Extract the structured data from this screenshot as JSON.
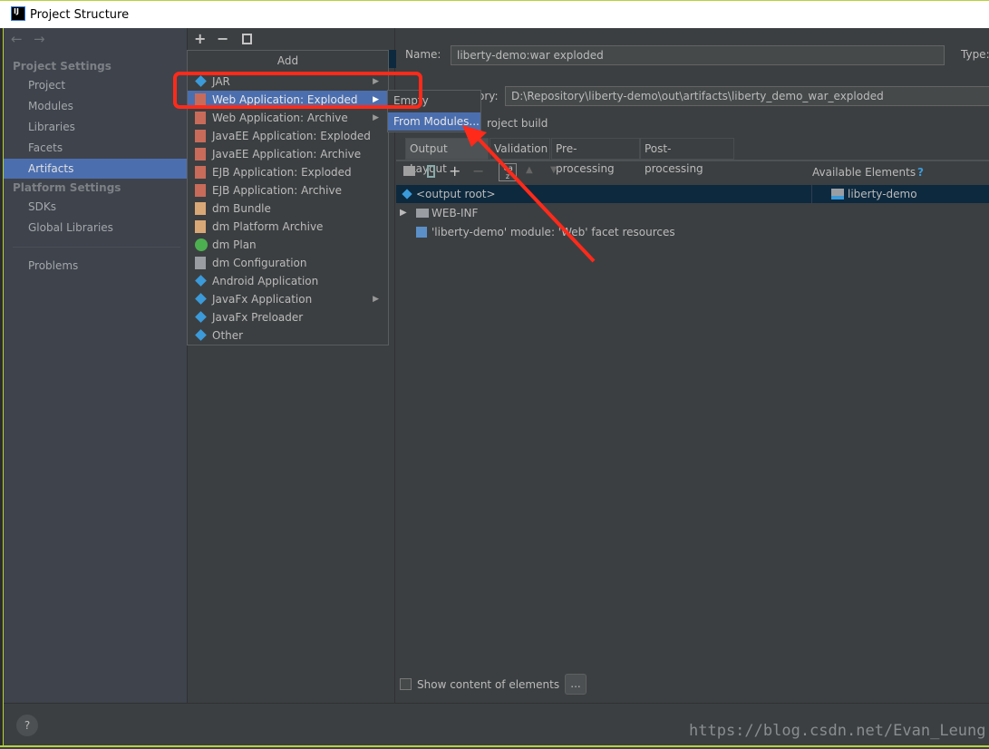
{
  "window": {
    "title": "Project Structure",
    "logo": "IJ"
  },
  "sidebar": {
    "section1": "Project Settings",
    "items1": [
      "Project",
      "Modules",
      "Libraries",
      "Facets",
      "Artifacts"
    ],
    "selected": "Artifacts",
    "section2": "Platform Settings",
    "items2": [
      "SDKs",
      "Global Libraries"
    ],
    "problems": "Problems"
  },
  "toolbar": {
    "add": "+",
    "remove": "−",
    "copy": "copy-icon"
  },
  "menu": {
    "header": "Add",
    "items": [
      {
        "label": "JAR",
        "icon": "jar-icon",
        "submenu": true
      },
      {
        "label": "Web Application: Exploded",
        "icon": "web-app-icon",
        "submenu": true,
        "selected": true
      },
      {
        "label": "Web Application: Archive",
        "icon": "web-app-icon",
        "submenu": true
      },
      {
        "label": "JavaEE Application: Exploded",
        "icon": "javaee-icon"
      },
      {
        "label": "JavaEE Application: Archive",
        "icon": "javaee-icon"
      },
      {
        "label": "EJB Application: Exploded",
        "icon": "ejb-icon"
      },
      {
        "label": "EJB Application: Archive",
        "icon": "ejb-icon"
      },
      {
        "label": "dm Bundle",
        "icon": "dm-bundle-icon"
      },
      {
        "label": "dm Platform Archive",
        "icon": "dm-archive-icon"
      },
      {
        "label": "dm Plan",
        "icon": "dm-plan-icon"
      },
      {
        "label": "dm Configuration",
        "icon": "document-icon"
      },
      {
        "label": "Android Application",
        "icon": "artifact-icon"
      },
      {
        "label": "JavaFx Application",
        "icon": "artifact-icon",
        "submenu": true
      },
      {
        "label": "JavaFx Preloader",
        "icon": "artifact-icon"
      },
      {
        "label": "Other",
        "icon": "artifact-icon"
      }
    ]
  },
  "submenu": {
    "items": [
      "Empty",
      "From Modules..."
    ],
    "selected": "From Modules..."
  },
  "form": {
    "name_label": "Name:",
    "name_value": "liberty-demo:war exploded",
    "type_label": "Type:",
    "output_label": "ory:",
    "output_value": "D:\\Repository\\liberty-demo\\out\\artifacts\\liberty_demo_war_exploded",
    "build_label": "roject build"
  },
  "tabs": [
    "Output Layout",
    "Validation",
    "Pre-processing",
    "Post-processing"
  ],
  "tree": {
    "rows": [
      "<output root>",
      "WEB-INF",
      "'liberty-demo' module: 'Web' facet resources"
    ],
    "available_label": "Available Elements",
    "available_help": "?",
    "available_items": [
      "liberty-demo"
    ]
  },
  "footer": {
    "show_content": "Show content of elements",
    "show_content_checked": false,
    "more": "...",
    "help": "?",
    "watermark": "https://blog.csdn.net/Evan_Leung"
  },
  "colors": {
    "selection": "#4b6eaf",
    "tree_selection": "#0d293e",
    "annotation": "#ff2a1a",
    "border_accent": "#b5d33a"
  }
}
